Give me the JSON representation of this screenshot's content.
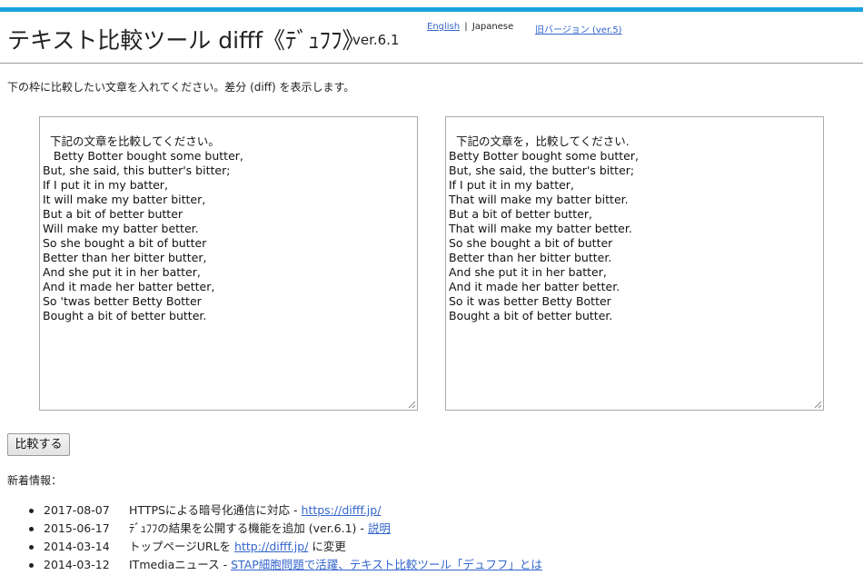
{
  "header": {
    "title": "テキスト比較ツール difff《ﾃﾞｭﾌﾌ》",
    "version": "ver.6.1",
    "lang_english": "English",
    "lang_separator": "|",
    "lang_japanese": "Japanese",
    "old_version": "旧バージョン (ver.5)"
  },
  "instruction": "下の枠に比較したい文章を入れてください。差分 (diff) を表示します。",
  "left_text": "下記の文章を比較してください。\n   Betty Botter bought some butter,\nBut, she said, this butter's bitter;\nIf I put it in my batter,\nIt will make my batter bitter,\nBut a bit of better butter\nWill make my batter better.\nSo she bought a bit of butter\nBetter than her bitter butter,\nAnd she put it in her batter,\nAnd it made her batter better,\nSo 'twas better Betty Botter\nBought a bit of better butter.",
  "right_text": "下記の文章を，比較してください.\nBetty Botter bought some butter,\nBut, she said, the butter's bitter;\nIf I put it in my batter,\nThat will make my batter bitter.\nBut a bit of better butter,\nThat will make my batter better.\nSo she bought a bit of butter\nBetter than her bitter butter.\nAnd she put it in her batter,\nAnd it made her batter better.\nSo it was better Betty Botter\nBought a bit of better butter.",
  "compare_button": "比較する",
  "news_heading": "新着情報：",
  "news": [
    {
      "date": "2017-08-07",
      "text": "HTTPSによる暗号化通信に対応 - ",
      "link": "https://difff.jp/",
      "after": ""
    },
    {
      "date": "2015-06-17",
      "text": "ﾃﾞｭﾌﾌの結果を公開する機能を追加 (ver.6.1) - ",
      "link": "説明",
      "after": ""
    },
    {
      "date": "2014-03-14",
      "text": "トップページURLを ",
      "link": "http://difff.jp/",
      "after": " に変更"
    },
    {
      "date": "2014-03-12",
      "text": "ITmediaニュース - ",
      "link": "STAP細胞問題で活躍、テキスト比較ツール「デュフフ」とは",
      "after": ""
    }
  ],
  "colors": {
    "accent_bar": "#1aa3dc",
    "link": "#3366cc"
  },
  "icons": {
    "textarea_resize": "resize-grip-icon",
    "list_bullet": "bullet-icon"
  }
}
